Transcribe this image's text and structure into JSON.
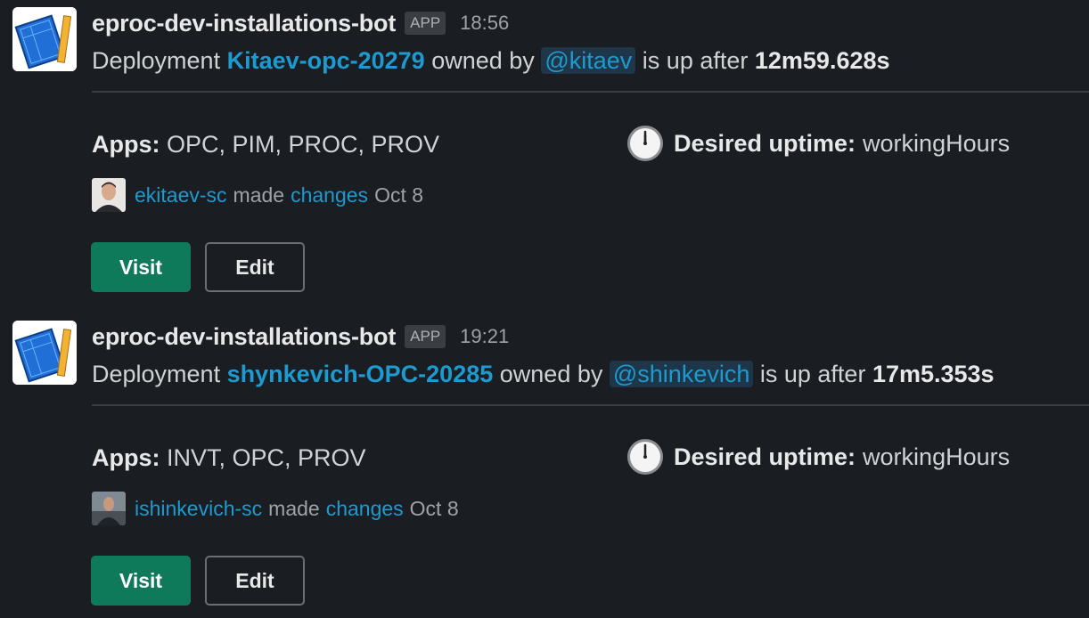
{
  "messages": [
    {
      "bot_name": "eproc-dev-installations-bot",
      "badge": "APP",
      "time": "18:56",
      "prefix": "Deployment",
      "deployment": "Kitaev-opc-20279",
      "owned_by": "owned by",
      "owner": "@kitaev",
      "is_up_after": "is up after",
      "duration": "12m59.628s",
      "apps_label": "Apps:",
      "apps_value": "OPC, PIM, PROC, PROV",
      "uptime_label": "Desired uptime:",
      "uptime_value": "workingHours",
      "changer": "ekitaev-sc",
      "made": "made",
      "changes_link": "changes",
      "date": "Oct 8",
      "visit_label": "Visit",
      "edit_label": "Edit"
    },
    {
      "bot_name": "eproc-dev-installations-bot",
      "badge": "APP",
      "time": "19:21",
      "prefix": "Deployment",
      "deployment": "shynkevich-OPC-20285",
      "owned_by": "owned by",
      "owner": "@shinkevich",
      "is_up_after": "is up after",
      "duration": "17m5.353s",
      "apps_label": "Apps:",
      "apps_value": "INVT, OPC, PROV",
      "uptime_label": "Desired uptime:",
      "uptime_value": "workingHours",
      "changer": "ishinkevich-sc",
      "made": "made",
      "changes_link": "changes",
      "date": "Oct 8",
      "visit_label": "Visit",
      "edit_label": "Edit"
    }
  ],
  "icons": {
    "avatar": "blueprint-icon",
    "uptime": "clock-icon"
  },
  "colors": {
    "background": "#1a1d21",
    "link": "#1d9bd1",
    "visit_button": "#0f7a5a"
  }
}
